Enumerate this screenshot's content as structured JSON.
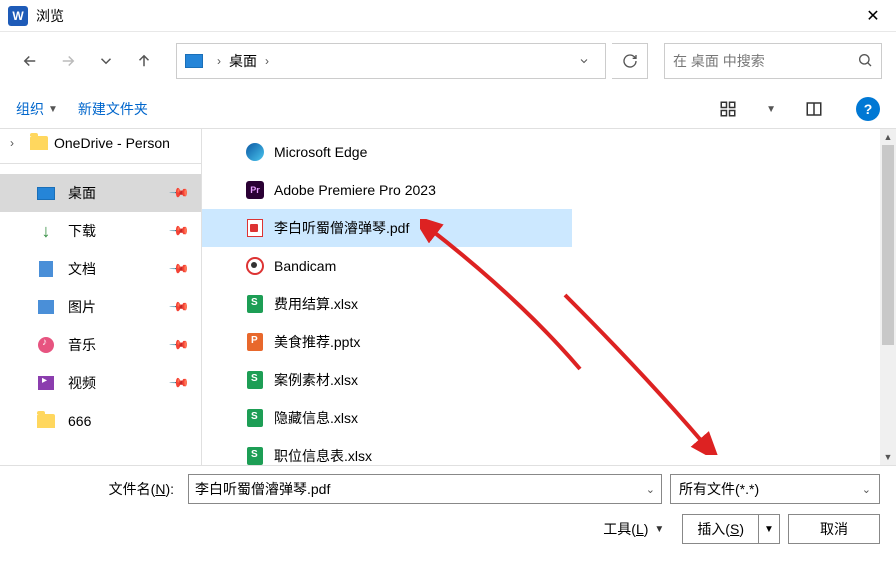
{
  "title": "浏览",
  "word_icon_letter": "W",
  "nav": {
    "path_crumb": "桌面",
    "search_placeholder": "在 桌面 中搜索"
  },
  "toolbar": {
    "organize": "组织",
    "new_folder": "新建文件夹"
  },
  "tree": {
    "onedrive": "OneDrive - Person"
  },
  "quick": [
    {
      "label": "桌面",
      "icon": "monitor",
      "active": true,
      "pinned": true
    },
    {
      "label": "下载",
      "icon": "download",
      "active": false,
      "pinned": true
    },
    {
      "label": "文档",
      "icon": "doc",
      "active": false,
      "pinned": true
    },
    {
      "label": "图片",
      "icon": "pic",
      "active": false,
      "pinned": true
    },
    {
      "label": "音乐",
      "icon": "music",
      "active": false,
      "pinned": true
    },
    {
      "label": "视频",
      "icon": "video",
      "active": false,
      "pinned": true
    },
    {
      "label": "666",
      "icon": "folder",
      "active": false,
      "pinned": false
    }
  ],
  "files": [
    {
      "name": "Microsoft Edge",
      "icon": "edge",
      "selected": false
    },
    {
      "name": "Adobe Premiere Pro 2023",
      "icon": "pr",
      "selected": false
    },
    {
      "name": "李白听蜀僧濬弹琴.pdf",
      "icon": "pdf",
      "selected": true
    },
    {
      "name": "Bandicam",
      "icon": "bandi",
      "selected": false
    },
    {
      "name": "费用结算.xlsx",
      "icon": "xlsx",
      "selected": false
    },
    {
      "name": "美食推荐.pptx",
      "icon": "pptx",
      "selected": false
    },
    {
      "name": "案例素材.xlsx",
      "icon": "xlsx",
      "selected": false
    },
    {
      "name": "隐藏信息.xlsx",
      "icon": "xlsx",
      "selected": false
    },
    {
      "name": "职位信息表.xlsx",
      "icon": "xlsx",
      "selected": false
    }
  ],
  "footer": {
    "filename_label_pre": "文件名(",
    "filename_label_u": "N",
    "filename_label_post": "):",
    "filename_value": "李白听蜀僧濬弹琴.pdf",
    "filetype": "所有文件(*.*)",
    "tools_pre": "工具(",
    "tools_u": "L",
    "tools_post": ")",
    "insert_pre": "插入(",
    "insert_u": "S",
    "insert_post": ")",
    "cancel": "取消"
  },
  "help_icon": "?"
}
